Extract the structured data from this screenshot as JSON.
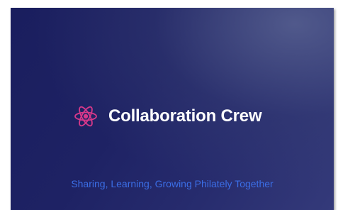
{
  "slide": {
    "title": "Collaboration Crew",
    "tagline": "Sharing, Learning, Growing Philately Together",
    "icon": "atom-icon",
    "colors": {
      "icon": "#d8388a",
      "title": "#ffffff",
      "tagline": "#3b6ee6",
      "background": "#1e2264"
    }
  }
}
